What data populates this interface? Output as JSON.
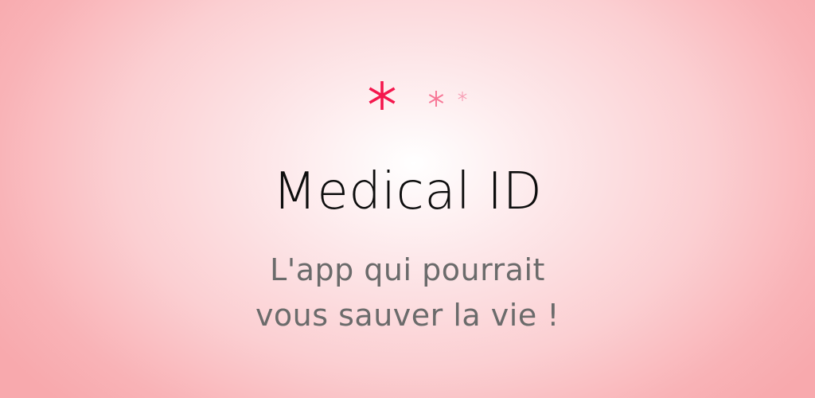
{
  "colors": {
    "primary_asterisk": "#f4174d",
    "secondary_asterisk": "#f77897",
    "tertiary_asterisk": "#f7a0b6",
    "background_center": "#ffffff",
    "background_edge": "#f8a9ad",
    "title_text": "#0d0d0d",
    "tagline_text": "#6b6b6b"
  },
  "logo": {
    "icon": "asterisk-trio-icon"
  },
  "app_title": "Medical ID",
  "tagline": {
    "line1": "L'app qui pourrait",
    "line2": "vous sauver la vie !"
  }
}
